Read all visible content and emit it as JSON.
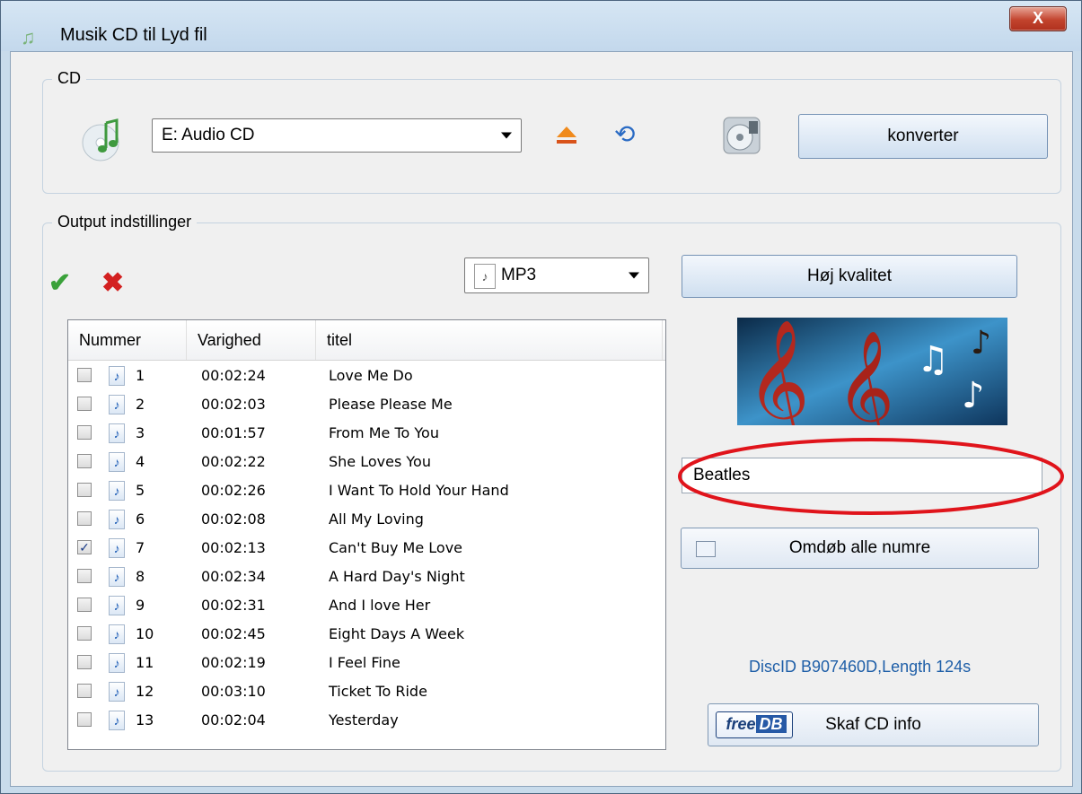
{
  "window": {
    "title": "Musik CD til Lyd fil",
    "close_label": "X"
  },
  "cd_group": {
    "legend": "CD",
    "drive": "E:  Audio CD",
    "convert_label": "konverter"
  },
  "output_group": {
    "legend": "Output indstillinger",
    "format": "MP3",
    "quality_label": "Høj kvalitet",
    "album_input_value": "Beatles",
    "rename_label": "Omdøb alle numre",
    "disc_info": "DiscID B907460D,Length 124s",
    "cdinfo_label": "Skaf CD info",
    "freedb_text_1": "free",
    "freedb_text_2": "DB"
  },
  "track_list": {
    "columns": [
      "Nummer",
      "Varighed",
      "titel"
    ],
    "rows": [
      {
        "num": "1",
        "duration": "00:02:24",
        "title": "Love Me Do",
        "checked": false
      },
      {
        "num": "2",
        "duration": "00:02:03",
        "title": "Please Please Me",
        "checked": false
      },
      {
        "num": "3",
        "duration": "00:01:57",
        "title": "From Me To You",
        "checked": false
      },
      {
        "num": "4",
        "duration": "00:02:22",
        "title": "She Loves You",
        "checked": false
      },
      {
        "num": "5",
        "duration": "00:02:26",
        "title": "I Want To Hold Your Hand",
        "checked": false
      },
      {
        "num": "6",
        "duration": "00:02:08",
        "title": "All My Loving",
        "checked": false
      },
      {
        "num": "7",
        "duration": "00:02:13",
        "title": "Can't Buy Me Love",
        "checked": true
      },
      {
        "num": "8",
        "duration": "00:02:34",
        "title": "A Hard Day's Night",
        "checked": false
      },
      {
        "num": "9",
        "duration": "00:02:31",
        "title": "And I love Her",
        "checked": false
      },
      {
        "num": "10",
        "duration": "00:02:45",
        "title": "Eight Days A Week",
        "checked": false
      },
      {
        "num": "11",
        "duration": "00:02:19",
        "title": "I Feel Fine",
        "checked": false
      },
      {
        "num": "12",
        "duration": "00:03:10",
        "title": "Ticket To Ride",
        "checked": false
      },
      {
        "num": "13",
        "duration": "00:02:04",
        "title": "Yesterday",
        "checked": false
      }
    ]
  },
  "colors": {
    "highlight_ellipse": "#e0141b",
    "disc_info": "#1f5fa8"
  }
}
